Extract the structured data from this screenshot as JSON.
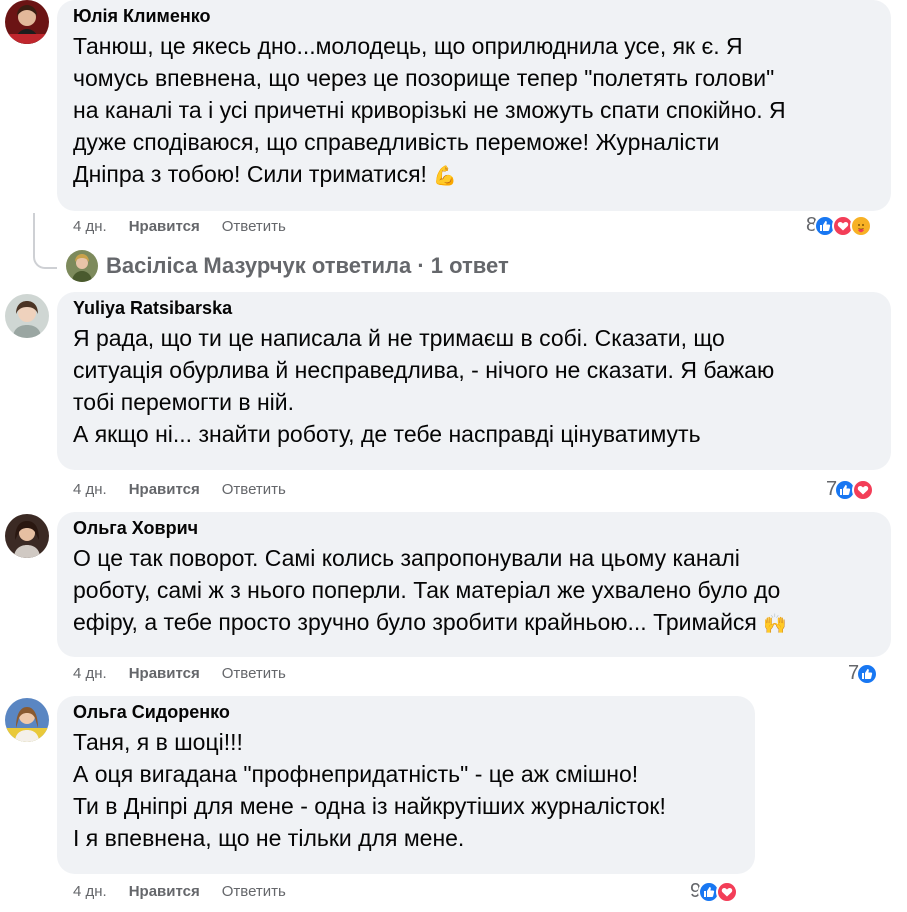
{
  "comments": [
    {
      "author": "Юлія Клименко",
      "lines": [
        "Танюш, це якесь дно...молодець, що оприлюднила усе, як є. Я",
        "чомусь впевнена, що через це позорище тепер \"полетять голови\"",
        "на каналі та і усі причетні криворізькі не зможуть спати спокійно. Я",
        "дуже сподіваюся, що справедливість переможе! Журналісти",
        "Дніпра з тобою! Сили триматися!"
      ],
      "emoji": "💪",
      "time": "4 дн.",
      "like_label": "Нравится",
      "reply_label": "Ответить",
      "reaction_count": "8",
      "reactions": [
        "like-icon",
        "love-icon",
        "care-icon"
      ]
    },
    {
      "author": "Yuliya Ratsibarska",
      "lines": [
        "Я рада, що ти це написала й не тримаєш в собі. Сказати, що",
        "ситуація обурлива й несправедлива, - нічого не сказати. Я бажаю",
        "тобі перемогти в ній.",
        "А якщо ні... знайти роботу, де тебе насправді цінуватимуть"
      ],
      "emoji": "",
      "time": "4 дн.",
      "like_label": "Нравится",
      "reply_label": "Ответить",
      "reaction_count": "7",
      "reactions": [
        "like-icon",
        "love-icon"
      ]
    },
    {
      "author": "Ольга Ховрич",
      "lines": [
        "О це так поворот. Самі колись запропонували на цьому каналі",
        "роботу, самі ж з нього поперли. Так матеріал же ухвалено було до",
        "ефіру, а тебе просто зручно було зробити крайньою... Тримайся"
      ],
      "emoji": "🙌",
      "time": "4 дн.",
      "like_label": "Нравится",
      "reply_label": "Ответить",
      "reaction_count": "7",
      "reactions": [
        "like-icon"
      ]
    },
    {
      "author": "Ольга Сидоренко",
      "lines": [
        "Таня, я в шоці!!!",
        "А оця вигадана \"профнепридатність\" - це аж смішно!",
        "Ти в Дніпрі для мене - одна із найкрутіших журналісток!",
        "І я впевнена, що не тільки для мене."
      ],
      "emoji": "",
      "time": "4 дн.",
      "like_label": "Нравится",
      "reply_label": "Ответить",
      "reaction_count": "9",
      "reactions": [
        "like-icon",
        "love-icon"
      ]
    }
  ],
  "replies_summary": "Васіліса Мазурчук ответила · 1 ответ",
  "colors": {
    "bubble": "#f0f2f5",
    "meta": "#65676b",
    "like": "#1877f2",
    "love": "#f33e58",
    "care": "#f7b125"
  }
}
